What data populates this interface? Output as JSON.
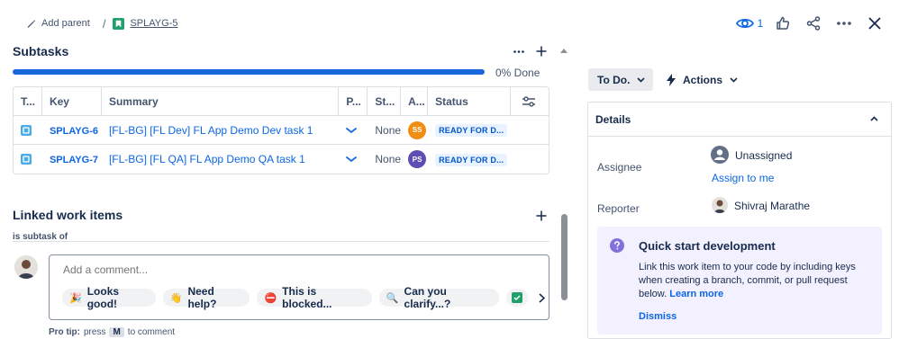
{
  "header": {
    "add_parent_label": "Add parent",
    "separator": "/",
    "issue_key": "SPLAYG-5",
    "watch_count": "1"
  },
  "subtasks": {
    "title": "Subtasks",
    "progress_fraction": 0,
    "progress_label": "0% Done",
    "columns": [
      "T...",
      "Key",
      "Summary",
      "P...",
      "St...",
      "A...",
      "Status"
    ],
    "rows": [
      {
        "key": "SPLAYG-6",
        "summary": "[FL-BG] [FL Dev] FL App Demo Dev task 1",
        "story_points": "None",
        "assignee_initials": "SS",
        "assignee_color": "#f18d13",
        "status": "READY FOR D..."
      },
      {
        "key": "SPLAYG-7",
        "summary": "[FL-BG] [FL QA] FL App Demo QA task 1",
        "story_points": "None",
        "assignee_initials": "PS",
        "assignee_color": "#5e4db2",
        "status": "READY FOR D..."
      }
    ]
  },
  "linked": {
    "title": "Linked work items",
    "relation": "is subtask of"
  },
  "comment": {
    "placeholder": "Add a comment...",
    "chips": [
      {
        "emoji": "🎉",
        "label": "Looks good!"
      },
      {
        "emoji": "👋",
        "label": "Need help?"
      },
      {
        "emoji": "⛔",
        "label": "This is blocked..."
      },
      {
        "emoji": "🔍",
        "label": "Can you clarify...?"
      }
    ],
    "pro_tip_label": "Pro tip:",
    "pro_tip_press": "press",
    "pro_tip_key": "M",
    "pro_tip_suffix": "to comment"
  },
  "sidebar": {
    "status_label": "To Do.",
    "actions_label": "Actions",
    "details_title": "Details",
    "assignee_label": "Assignee",
    "assignee_value": "Unassigned",
    "assign_to_me": "Assign to me",
    "reporter_label": "Reporter",
    "reporter_value": "Shivraj Marathe",
    "quick_start": {
      "title": "Quick start development",
      "body_line1": "Link this work item to your code by including keys",
      "body_line2": "when creating a branch, commit, or pull request",
      "body_line3": "below.",
      "learn_more": "Learn more",
      "dismiss": "Dismiss"
    }
  },
  "colors": {
    "accent": "#0c66e4",
    "progress": "#1868db",
    "text": "#172b4d",
    "subtle": "#44546f",
    "quick_bg": "#f3f0ff",
    "quick_icon": "#8270db"
  }
}
